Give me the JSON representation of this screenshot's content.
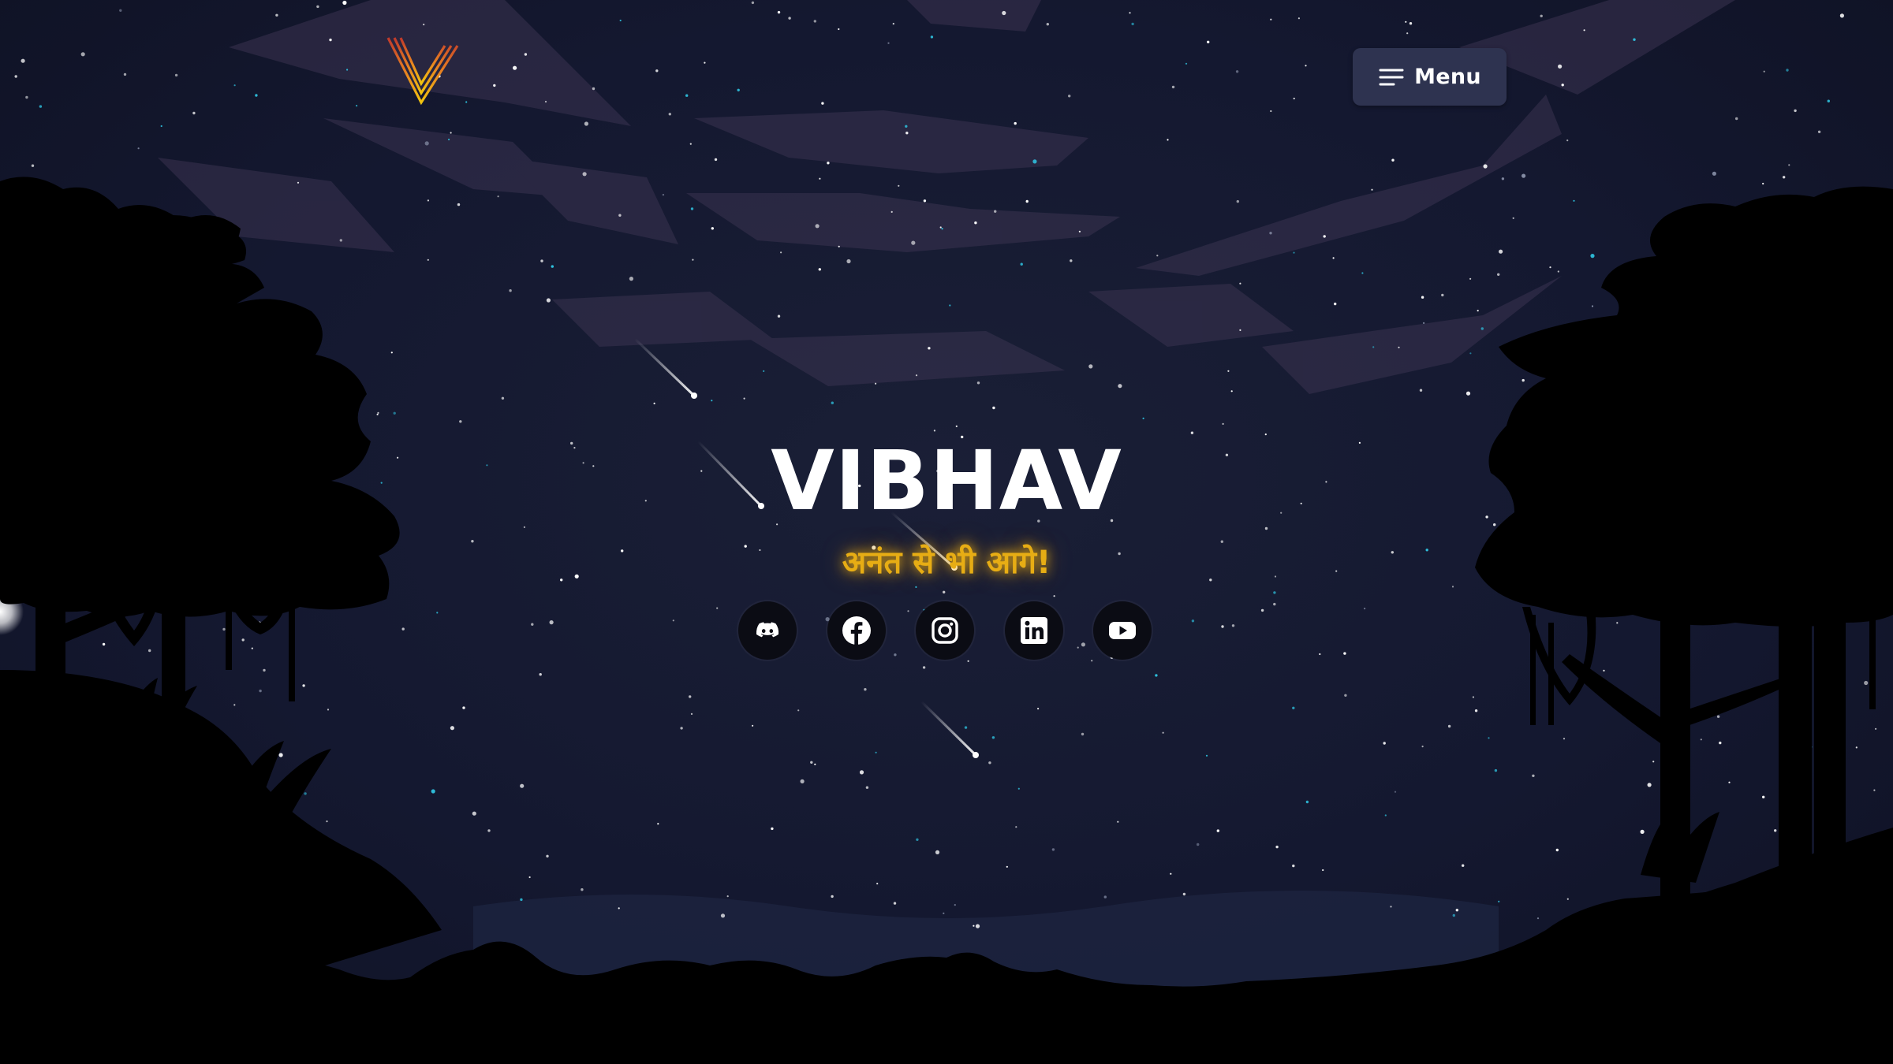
{
  "header": {
    "logo_icon": "v-logo-icon",
    "menu_label": "Menu",
    "menu_icon": "hamburger-icon"
  },
  "hero": {
    "title": "VIBHAV",
    "tagline": "अनंत से भी आगे!",
    "tagline_color": "#e7ad14"
  },
  "socials": [
    {
      "name": "Discord",
      "icon": "discord-icon"
    },
    {
      "name": "Facebook",
      "icon": "facebook-icon"
    },
    {
      "name": "Instagram",
      "icon": "instagram-icon"
    },
    {
      "name": "LinkedIn",
      "icon": "linkedin-icon"
    },
    {
      "name": "YouTube",
      "icon": "youtube-icon"
    }
  ],
  "colors": {
    "sky": "#141829",
    "menu_button": "#2e3350",
    "silhouette": "#000000",
    "logo_gradient": [
      "#c0392b",
      "#f1c40f"
    ]
  }
}
